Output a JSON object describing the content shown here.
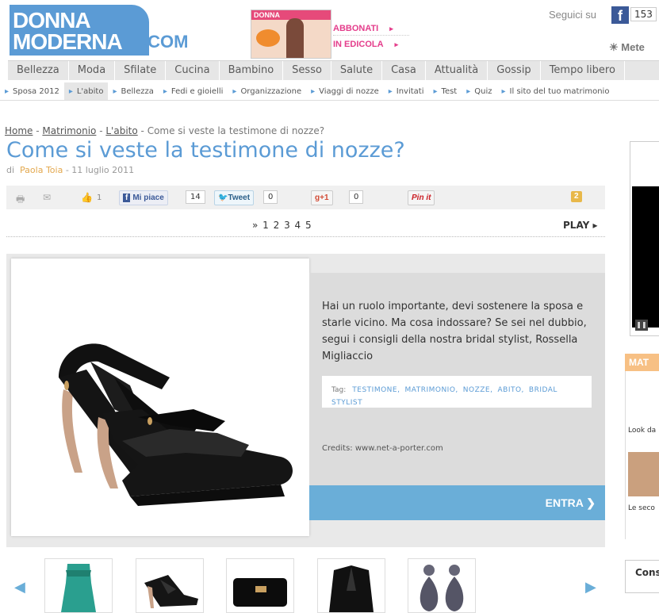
{
  "header": {
    "logo_line1": "DONNA",
    "logo_line2": "MODERNA",
    "logo_dotcom": ".COM",
    "magazine_label": "DONNA",
    "subscribe": "ABBONATI",
    "newsstand": "IN EDICOLA",
    "follow": "Seguici su",
    "fb_count": "153",
    "weather": "Mete"
  },
  "nav": {
    "main": [
      "Bellezza",
      "Moda",
      "Sfilate",
      "Cucina",
      "Bambino",
      "Sesso",
      "Salute",
      "Casa",
      "Attualità",
      "Gossip",
      "Tempo libero"
    ],
    "sub": [
      "Sposa 2012",
      "L'abito",
      "Bellezza",
      "Fedi e gioielli",
      "Organizzazione",
      "Viaggi di nozze",
      "Invitati",
      "Test",
      "Quiz",
      "Il sito del tuo matrimonio"
    ],
    "sub_active_index": 1
  },
  "breadcrumb": {
    "home": "Home",
    "sep": " - ",
    "matrimonio": "Matrimonio",
    "abito": "L'abito",
    "current": "Come si veste la testimone di nozze?"
  },
  "article": {
    "title": "Come si veste la testimone di nozze?",
    "by": "di",
    "author": "Paola Toia",
    "date_sep": " - ",
    "date": "11 luglio 2011",
    "intro": "Hai un ruolo importante, devi sostenere la sposa e starle vicino. Ma cosa indossare? Se sei nel dubbio, segui i consigli della nostra bridal stylist, Rossella Migliaccio",
    "tags_label": "Tag:",
    "tags": [
      "TESTIMONE,",
      "MATRIMONIO,",
      "NOZZE,",
      "ABITO,",
      "BRIDAL STYLIST"
    ],
    "credits": "Credits: www.net-a-porter.com",
    "enter": "ENTRA ❯"
  },
  "share": {
    "like_count": "1",
    "fb_like": "Mi piace",
    "fb_like_count": "14",
    "tweet": "Tweet",
    "tweet_count": "0",
    "gplus": "+1",
    "gplus_count": "0",
    "pinit": "Pin it",
    "comments": "2"
  },
  "pager": {
    "prefix": "»",
    "pages": "1 2 3 4 5",
    "play": "PLAY"
  },
  "sidebar": {
    "section": "MAT",
    "caption1": "Look da",
    "caption2": "Le seco",
    "cons": "Cons"
  },
  "colors": {
    "brand_blue": "#5b9bd5",
    "accent_pink": "#e43d8b",
    "enter_blue": "#6aaed8"
  }
}
